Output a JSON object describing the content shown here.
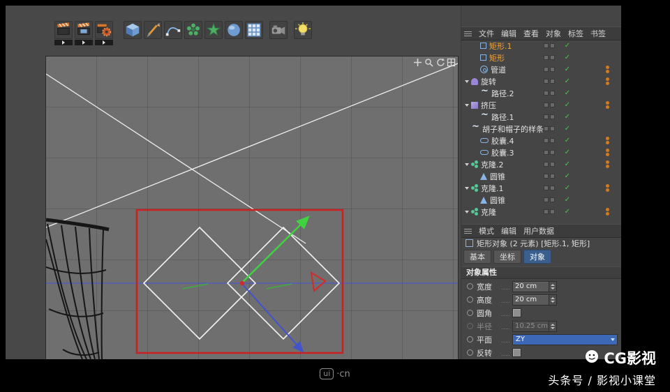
{
  "colors": {
    "selection_red": "#c92222",
    "axis_green": "#3fd43f",
    "axis_blue": "#4353cc",
    "selected_orange": "#f2a53c",
    "check_green": "#4ec44e",
    "dot_orange": "#cf7c22",
    "plane_dropdown_blue": "#3d68b8"
  },
  "toolbar": {
    "icons": [
      "render-view-icon",
      "render-picture-viewer-icon",
      "render-settings-icon",
      "cube-primitive-icon",
      "spline-pen-icon",
      "spline-arc-icon",
      "flower-spline-icon",
      "star-spline-icon",
      "subdivision-surface-icon",
      "array-icon",
      "camera-icon",
      "light-icon"
    ]
  },
  "viewport": {
    "nav_icons": [
      "pan-view-icon",
      "zoom-view-icon",
      "rotate-view-icon",
      "toggle-view-icon"
    ]
  },
  "object_manager": {
    "menu_items": [
      "文件",
      "编辑",
      "查看",
      "对象",
      "标签",
      "书签"
    ],
    "items": [
      {
        "label": "矩形.1",
        "icon": "rectangle-icon",
        "selected": true,
        "indent": 1,
        "expand": false,
        "check": true,
        "dots": false
      },
      {
        "label": "矩形",
        "icon": "rectangle-icon",
        "selected": true,
        "indent": 1,
        "expand": false,
        "check": true,
        "dots": false
      },
      {
        "label": "管道",
        "icon": "tube-icon",
        "indent": 1,
        "expand": false,
        "check": true,
        "dots": true
      },
      {
        "label": "旋转",
        "icon": "lathe-icon",
        "indent": 0,
        "expand": true,
        "check": true,
        "dots": true
      },
      {
        "label": "路径.2",
        "icon": "spline-icon",
        "indent": 1,
        "expand": false,
        "check": true,
        "dots": false
      },
      {
        "label": "挤压",
        "icon": "extrude-icon",
        "indent": 0,
        "expand": true,
        "check": true,
        "dots": true
      },
      {
        "label": "路径.1",
        "icon": "spline-icon",
        "indent": 1,
        "expand": false,
        "check": true,
        "dots": false
      },
      {
        "label": "胡子和帽子的样条",
        "icon": "spline-icon",
        "indent": 0,
        "expand": false,
        "check": true,
        "dots": false
      },
      {
        "label": "胶囊.4",
        "icon": "capsule-icon",
        "indent": 1,
        "expand": false,
        "check": true,
        "dots": true
      },
      {
        "label": "胶囊.3",
        "icon": "capsule-icon",
        "indent": 1,
        "expand": false,
        "check": true,
        "dots": true
      },
      {
        "label": "克隆.2",
        "icon": "cloner-icon",
        "indent": 0,
        "expand": true,
        "check": true,
        "dots": true
      },
      {
        "label": "圆锥",
        "icon": "cone-icon",
        "indent": 1,
        "expand": false,
        "check": true,
        "dots": false
      },
      {
        "label": "克隆.1",
        "icon": "cloner-icon",
        "indent": 0,
        "expand": true,
        "check": true,
        "dots": true
      },
      {
        "label": "圆锥",
        "icon": "cone-icon",
        "indent": 1,
        "expand": false,
        "check": true,
        "dots": false
      },
      {
        "label": "克隆",
        "icon": "cloner-icon",
        "indent": 0,
        "expand": true,
        "check": true,
        "dots": true
      }
    ]
  },
  "attribute_manager": {
    "menu_items": [
      "模式",
      "编辑",
      "用户数据"
    ],
    "object_info": "矩形对象 (2 元素) [矩形.1, 矩形]",
    "tabs": [
      "基本",
      "坐标",
      "对象"
    ],
    "active_tab": "对象",
    "section_title": "对象属性",
    "properties": [
      {
        "label": "宽度",
        "value": "20 cm",
        "type": "stepper"
      },
      {
        "label": "高度",
        "value": "20 cm",
        "type": "stepper"
      },
      {
        "label": "圆角",
        "type": "checkbox"
      },
      {
        "label": "半径",
        "value": "10.25 cm",
        "type": "stepper",
        "disabled": true
      },
      {
        "label": "平面",
        "value": "ZY",
        "type": "dropdown",
        "highlight": true
      },
      {
        "label": "反转",
        "type": "checkbox"
      }
    ]
  },
  "watermark": {
    "logo": "ui",
    "domain": "·cn"
  },
  "footer": {
    "brand": "CG影视",
    "subtitle": "头条号 / 影视小课堂"
  }
}
